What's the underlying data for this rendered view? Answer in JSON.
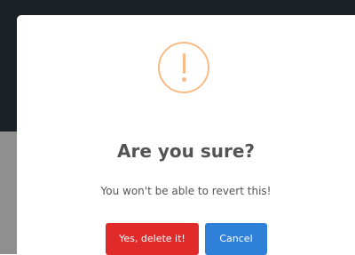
{
  "dialog": {
    "icon": "warning-icon",
    "title": "Are you sure?",
    "message": "You won't be able to revert this!",
    "confirm_label": "Yes, delete it!",
    "cancel_label": "Cancel"
  },
  "colors": {
    "warning": "#f8bb86",
    "confirm": "#e12b2b",
    "cancel": "#2f80d8",
    "text": "#545454"
  }
}
